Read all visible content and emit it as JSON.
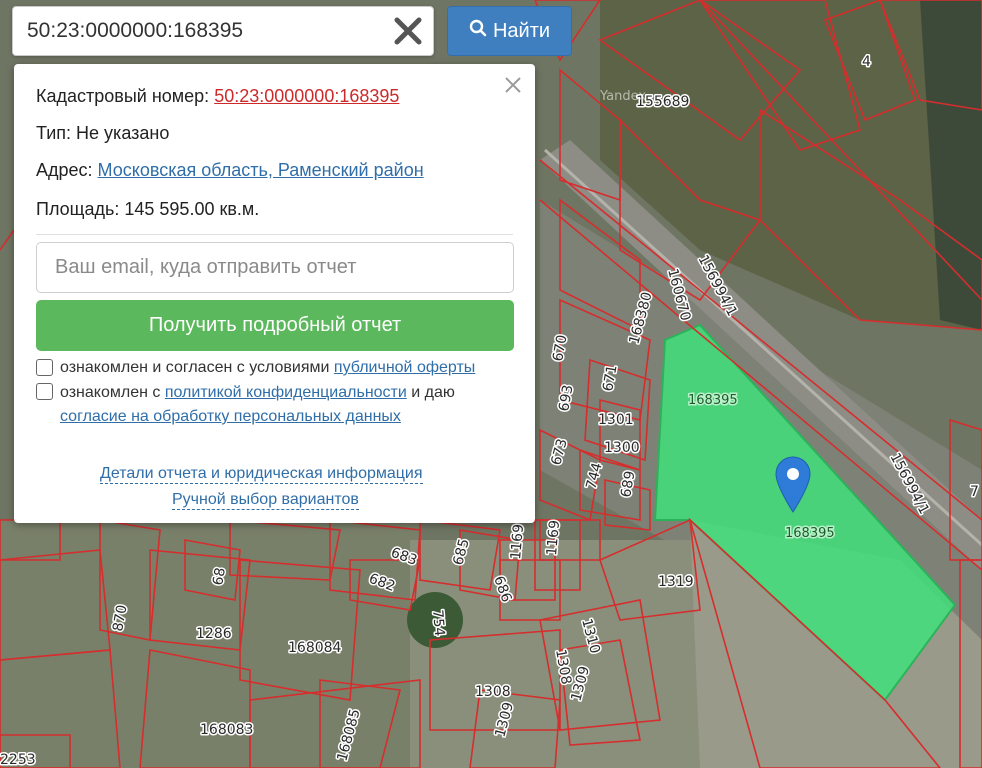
{
  "search": {
    "value": "50:23:0000000:168395",
    "button_label": "Найти",
    "search_icon": "search-icon",
    "clear_icon": "close-icon"
  },
  "popup": {
    "close_icon": "close-icon",
    "cadastral_label": "Кадастровый номер:",
    "cadastral_value": "50:23:0000000:168395",
    "type_label": "Тип:",
    "type_value": "Не указано",
    "address_label": "Адрес:",
    "address_value": "Московская область, Раменский район",
    "area_label": "Площадь:",
    "area_value": "145 595.00 кв.м.",
    "email_placeholder": "Ваш email, куда отправить отчет",
    "report_button": "Получить подробный отчет",
    "consent1_prefix": "ознакомлен и согласен с условиями",
    "consent1_link": "публичной оферты",
    "consent2_prefix": "ознакомлен с",
    "consent2_link": "политикой конфиденциальности",
    "consent2_suffix": "и даю",
    "consent2_link2": "согласие на обработку персональных данных",
    "details_link": "Детали отчета и юридическая информация",
    "manual_link": "Ручной выбор вариантов"
  },
  "map": {
    "selected_parcel": "168395",
    "marker_icon": "map-pin-icon",
    "watermark": "Yandex",
    "colors": {
      "parcel_border": "#d62d2d",
      "selected_fill": "#3fe07a",
      "search_button": "#3f7fbf",
      "report_button": "#5cb85c"
    },
    "labels": [
      "4",
      "155689",
      "156994/1",
      "160670",
      "168380",
      "168395",
      "168395",
      "156994/1",
      "1301",
      "1300",
      "670",
      "671",
      "693",
      "673",
      "744",
      "689",
      "685",
      "683",
      "682",
      "686",
      "1169",
      "1169",
      "1319",
      "754",
      "1310",
      "1308",
      "1308",
      "1309",
      "1309",
      "1286",
      "168084",
      "168083",
      "168085",
      "870",
      "68",
      "2253",
      "7"
    ]
  }
}
